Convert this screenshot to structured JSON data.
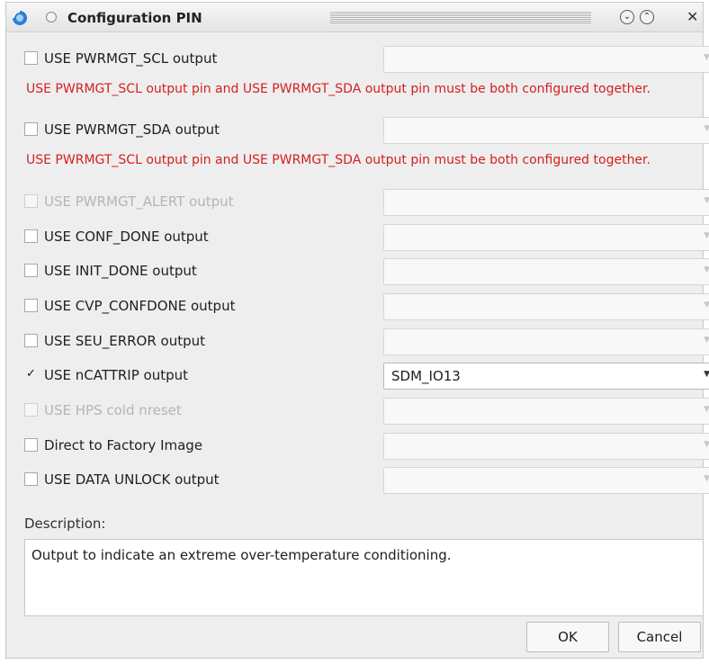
{
  "window": {
    "title": "Configuration PIN",
    "collapse_glyph": "⌄",
    "expand_glyph": "⌃",
    "close_glyph": "✕",
    "app_icon": "gear-globe-icon"
  },
  "checkmark": "✓",
  "arrow_glyph": "▼",
  "warning_text": "USE PWRMGT_SCL output pin and USE PWRMGT_SDA output pin must be both configured together.",
  "rows": [
    {
      "label": "USE PWRMGT_SCL output",
      "checked": false,
      "disabled": false,
      "value": ""
    },
    {
      "label": "USE PWRMGT_SDA output",
      "checked": false,
      "disabled": false,
      "value": ""
    },
    {
      "label": "USE PWRMGT_ALERT output",
      "checked": false,
      "disabled": true,
      "value": ""
    },
    {
      "label": "USE CONF_DONE output",
      "checked": false,
      "disabled": false,
      "value": ""
    },
    {
      "label": "USE INIT_DONE output",
      "checked": false,
      "disabled": false,
      "value": ""
    },
    {
      "label": "USE CVP_CONFDONE output",
      "checked": false,
      "disabled": false,
      "value": ""
    },
    {
      "label": "USE SEU_ERROR output",
      "checked": false,
      "disabled": false,
      "value": ""
    },
    {
      "label": "USE nCATTRIP output",
      "checked": true,
      "disabled": false,
      "value": "SDM_IO13"
    },
    {
      "label": "USE HPS cold nreset",
      "checked": false,
      "disabled": true,
      "value": ""
    },
    {
      "label": "Direct to Factory Image",
      "checked": false,
      "disabled": false,
      "value": ""
    },
    {
      "label": "USE DATA UNLOCK output",
      "checked": false,
      "disabled": false,
      "value": ""
    }
  ],
  "description": {
    "label": "Description:",
    "text": "Output to indicate an extreme over-temperature conditioning."
  },
  "buttons": {
    "ok": "OK",
    "cancel": "Cancel"
  },
  "colors": {
    "warning": "#d42020",
    "disabled_text": "#b5b5b5"
  }
}
